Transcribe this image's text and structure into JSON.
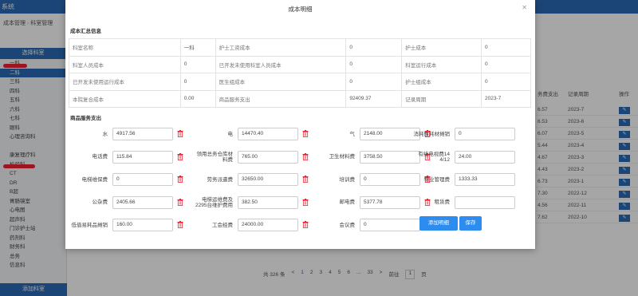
{
  "app": {
    "title": "系统"
  },
  "breadcrumb": [
    "成本管理",
    "科室管理"
  ],
  "sidebar": {
    "header": "选择科室",
    "items": [
      "一科",
      "二科",
      "三科",
      "四科",
      "五科",
      "六科",
      "七科",
      "眼科",
      "心理咨询科",
      "",
      "康复理疗科",
      "检验科",
      "CT",
      "DR",
      "B超",
      "胃肠镜室",
      "心电图",
      "超声科",
      "门诊护士站",
      "药剂科",
      "财务科",
      "总务",
      "信息科"
    ],
    "active_index": 1,
    "footer": "添加科室"
  },
  "bg_table": {
    "headers": [
      "务费支出",
      "记录周期",
      "操作"
    ],
    "rows": [
      [
        "6.57",
        "2023-7"
      ],
      [
        "6.53",
        "2023-6"
      ],
      [
        "6.07",
        "2023-5"
      ],
      [
        "5.44",
        "2023-4"
      ],
      [
        "4.67",
        "2023-3"
      ],
      [
        "4.43",
        "2023-2"
      ],
      [
        "6.73",
        "2023-1"
      ],
      [
        "7.30",
        "2022-12"
      ],
      [
        "4.56",
        "2022-11"
      ],
      [
        "7.62",
        "2022-10"
      ]
    ],
    "edit_label": "✎"
  },
  "pager": {
    "total": "共 326 条",
    "pages": [
      "<",
      "1",
      "2",
      "3",
      "4",
      "5",
      "6",
      "...",
      "33",
      ">"
    ],
    "current": "1",
    "goto": "前往",
    "page_input": "1",
    "page_suffix": "页"
  },
  "modal": {
    "title": "成本明细",
    "close_icon": "close-icon",
    "summary_title": "成本汇总信息",
    "summary": [
      [
        "科室名称",
        "一科",
        "护士工资成本",
        "0",
        "护士成本",
        "0"
      ],
      [
        "科室人员成本",
        "0",
        "已开发未使用科室人员成本",
        "0",
        "科室运行成本",
        "0"
      ],
      [
        "已开发未使用运行成本",
        "0",
        "医生组成本",
        "0",
        "护士组成本",
        "0"
      ],
      [
        "本院复合成本",
        "0.00",
        "商品服务支出",
        "92409.37",
        "记录周期",
        "2023-7"
      ]
    ],
    "services_title": "商品服务支出",
    "fields": [
      [
        {
          "label": "水",
          "value": "4917.56"
        },
        {
          "label": "电",
          "value": "14470.40"
        },
        {
          "label": "气",
          "value": "2148.00"
        },
        {
          "label": "消耗性耗材摊销",
          "value": "0"
        }
      ],
      [
        {
          "label": "电话费",
          "value": "115.84"
        },
        {
          "label": "领用总务仓库材料费",
          "value": "765.00"
        },
        {
          "label": "卫生材料费",
          "value": "3758.50"
        },
        {
          "label": "有线电视费14 4/12",
          "value": "24.00"
        }
      ],
      [
        {
          "label": "电梯维保费",
          "value": "0"
        },
        {
          "label": "劳务派遣费",
          "value": "32650.00"
        },
        {
          "label": "培训费",
          "value": "0"
        },
        {
          "label": "物业管理费",
          "value": "1333.33"
        }
      ],
      [
        {
          "label": "公杂费",
          "value": "2405.66"
        },
        {
          "label": "电梯运维费及2295台维护费用",
          "value": "382.50"
        },
        {
          "label": "邮电费",
          "value": "5377.78"
        },
        {
          "label": "租赁费",
          "value": ""
        }
      ],
      [
        {
          "label": "低值易耗品摊销",
          "value": "160.00"
        },
        {
          "label": "工会经费",
          "value": "24000.00"
        },
        {
          "label": "会议费",
          "value": "0"
        }
      ]
    ],
    "add_button": "添加明细",
    "save_button": "保存"
  },
  "colors": {
    "primary": "#2d8cf0",
    "brand": "#2a6ab5",
    "danger": "#e23"
  }
}
